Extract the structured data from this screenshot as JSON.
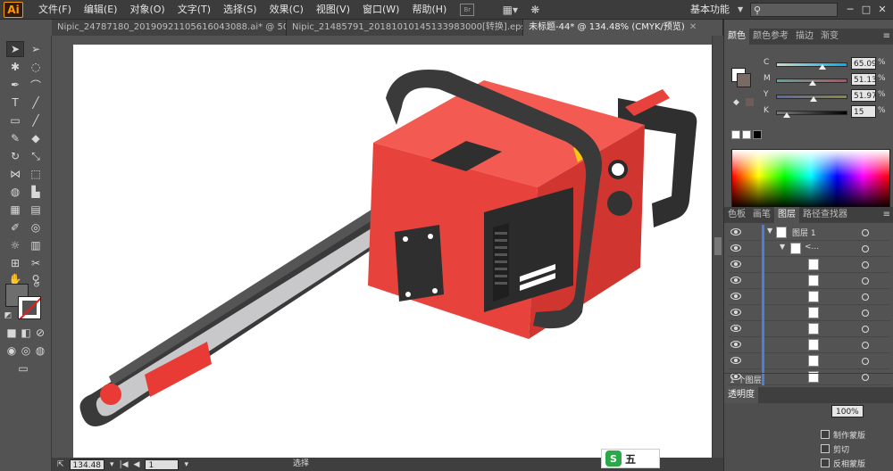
{
  "app": {
    "logo": "Ai",
    "menu": [
      "文件(F)",
      "编辑(E)",
      "对象(O)",
      "文字(T)",
      "选择(S)",
      "效果(C)",
      "视图(V)",
      "窗口(W)",
      "帮助(H)"
    ],
    "workspace": "基本功能"
  },
  "tabs": [
    {
      "label": "Nipic_24787180_20190921105616043088.ai* @ 50...",
      "active": false
    },
    {
      "label": "Nipic_21485791_20181010145133983000[转换].eps*",
      "active": false
    },
    {
      "label": "未标题-44* @ 134.48% (CMYK/预览)",
      "active": true
    }
  ],
  "color_panel": {
    "tabs": [
      "颜色",
      "颜色参考",
      "描边",
      "渐变"
    ],
    "channels": [
      {
        "label": "C",
        "value": "65.09",
        "level": 0.65,
        "color": "#00aeef"
      },
      {
        "label": "M",
        "value": "51.13",
        "level": 0.51,
        "color": "#ec008c"
      },
      {
        "label": "Y",
        "value": "51.97",
        "level": 0.52,
        "color": "#fff200"
      },
      {
        "label": "K",
        "value": "15",
        "level": 0.15,
        "color": "#000000"
      }
    ],
    "unit": "%"
  },
  "layers_panel": {
    "tabs": [
      "色板",
      "画笔",
      "图层",
      "路径查找器"
    ],
    "top_layer": "图层 1",
    "sub_group": "<...",
    "footer": "1 个图层"
  },
  "transparency_panel": {
    "title": "透明度",
    "opacity": "100%",
    "options": [
      "制作蒙版",
      "剪切",
      "反相蒙版"
    ]
  },
  "status": {
    "zoom": "134.48",
    "page": "1",
    "tool": "选择"
  },
  "ime": {
    "logo": "S",
    "label": "五"
  },
  "colors": {
    "body_red": "#e8423d",
    "top_red": "#f35a52",
    "dark": "#2b2b2b",
    "bar_gray": "#c7c7c9",
    "accent_yellow": "#f6c615"
  }
}
